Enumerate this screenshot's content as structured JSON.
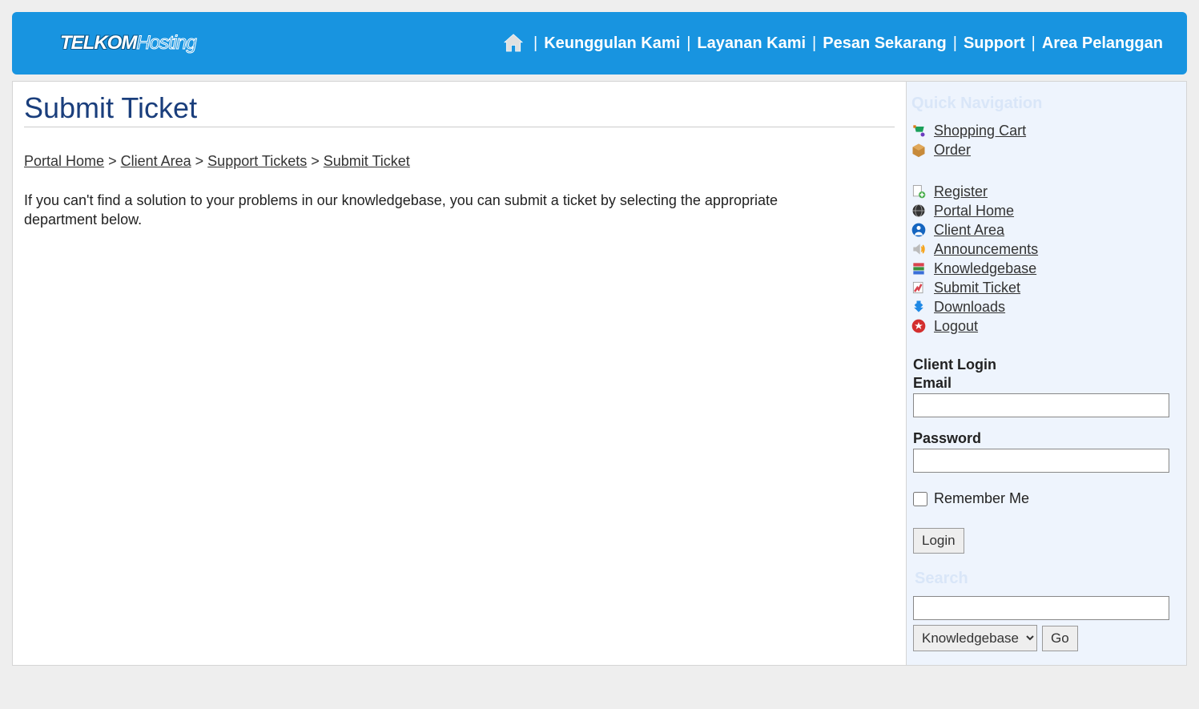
{
  "header": {
    "logo_a": "TELKOM",
    "logo_b": "Hosting",
    "nav": {
      "keunggulan": "Keunggulan Kami",
      "layanan": "Layanan Kami",
      "pesan": "Pesan Sekarang",
      "support": "Support",
      "area": "Area Pelanggan"
    }
  },
  "page": {
    "title": "Submit Ticket",
    "intro": "If you can't find a solution to your problems in our knowledgebase, you can submit a ticket by selecting the appropriate department below."
  },
  "breadcrumb": {
    "portal": "Portal Home",
    "client": "Client Area",
    "tickets": "Support Tickets",
    "current": "Submit Ticket",
    "sep": ">"
  },
  "sidebar": {
    "quicknav_title": "Quick Navigation",
    "items": {
      "cart": "Shopping Cart",
      "order": "Order",
      "register": "Register",
      "portal": "Portal Home",
      "client": "Client Area",
      "announce": "Announcements",
      "kb": "Knowledgebase",
      "ticket": "Submit Ticket",
      "downloads": "Downloads",
      "logout": "Logout"
    },
    "login": {
      "title": "Client Login",
      "email_label": "Email",
      "email_value": "",
      "password_label": "Password",
      "password_value": "",
      "remember": "Remember Me",
      "button": "Login"
    },
    "search": {
      "title": "Search",
      "value": "",
      "select": "Knowledgebase",
      "go": "Go"
    }
  }
}
